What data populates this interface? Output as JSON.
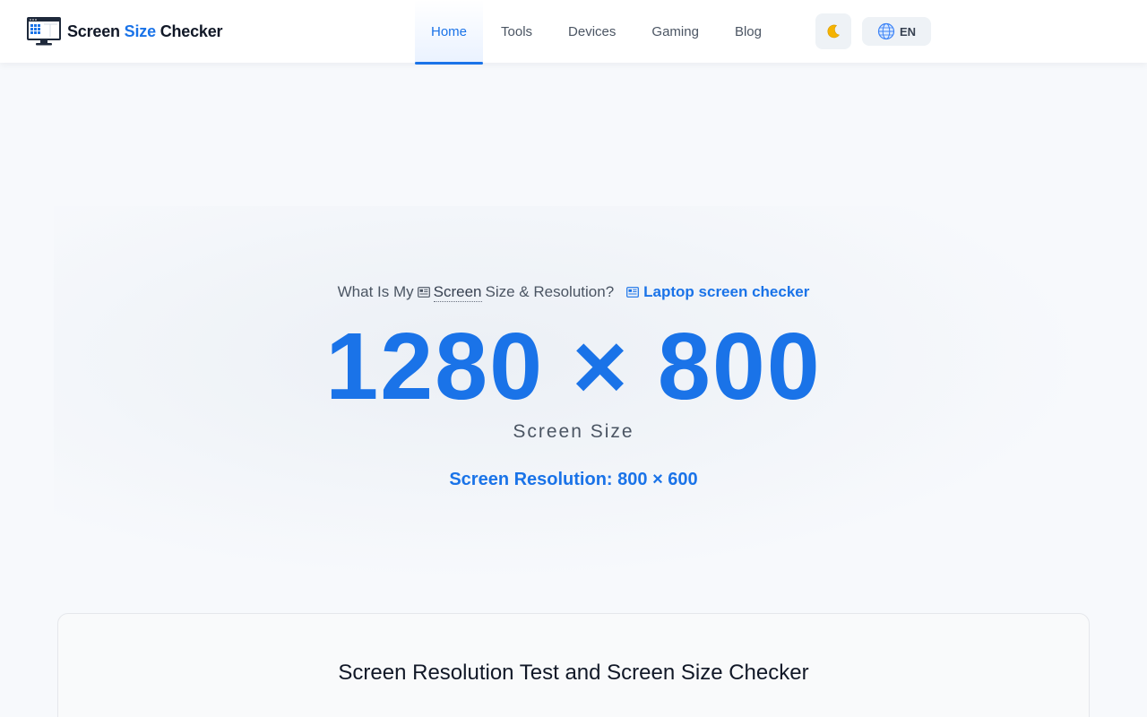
{
  "header": {
    "logo": {
      "text_main": "Screen",
      "text_accent": "Size",
      "text_end": "Checker"
    },
    "nav": [
      {
        "label": "Home",
        "active": true
      },
      {
        "label": "Tools",
        "active": false
      },
      {
        "label": "Devices",
        "active": false
      },
      {
        "label": "Gaming",
        "active": false
      },
      {
        "label": "Blog",
        "active": false
      }
    ],
    "theme_toggle_icon": "moon-icon",
    "language": {
      "icon": "globe-icon",
      "code": "EN"
    }
  },
  "hero": {
    "question_prefix": "What Is My",
    "question_screen": "Screen",
    "question_suffix": "Size & Resolution?",
    "link_label": "Laptop screen checker",
    "size_value": "1280 × 800",
    "size_caption": "Screen Size",
    "resolution_text": "Screen Resolution: 800 × 600"
  },
  "card": {
    "title": "Screen Resolution Test and Screen Size Checker"
  },
  "colors": {
    "accent": "#1a73e8",
    "background": "#f7f9fc",
    "header_bg": "#ffffff"
  }
}
